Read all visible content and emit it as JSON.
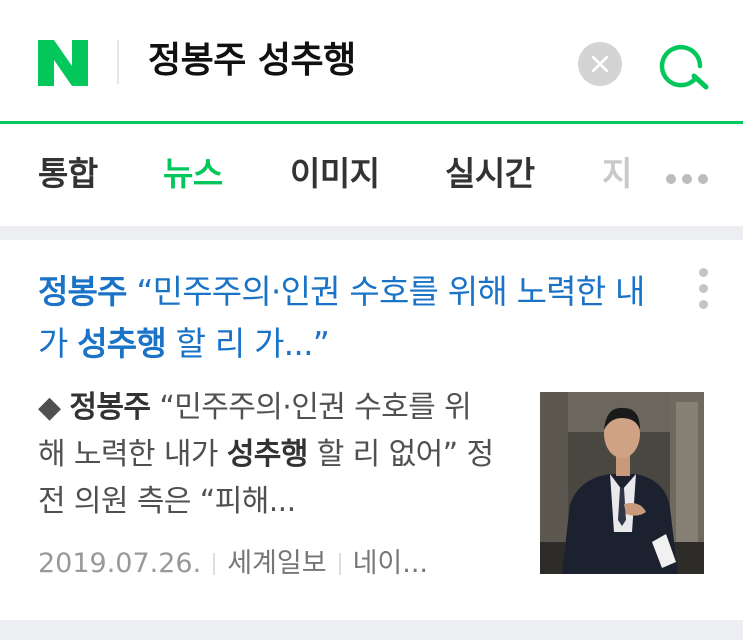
{
  "header": {
    "logo_letter": "N",
    "query": "정봉주 성추행",
    "clear_icon": "close-icon",
    "search_icon": "search-icon",
    "brand_color": "#03c75a"
  },
  "tabs": [
    {
      "label": "통합",
      "active": false
    },
    {
      "label": "뉴스",
      "active": true
    },
    {
      "label": "이미지",
      "active": false
    },
    {
      "label": "실시간",
      "active": false
    },
    {
      "label": "지",
      "active": false
    }
  ],
  "news": {
    "headline": {
      "p1": "정봉주",
      "p2": " “민주주의·인권 수호를 위해 노력한 내가 ",
      "p3": "성추행",
      "p4": " 할 리 가...”"
    },
    "snippet": {
      "s1": "◆ ",
      "s2": "정봉주",
      "s3": " “민주주의·인권 수호를 위해 노력한 내가 ",
      "s4": "성추행",
      "s5": " 할 리 없어” 정 전 의원 측은 “피해..."
    },
    "date": "2019.07.26.",
    "press": "세계일보",
    "source": "네이..."
  }
}
